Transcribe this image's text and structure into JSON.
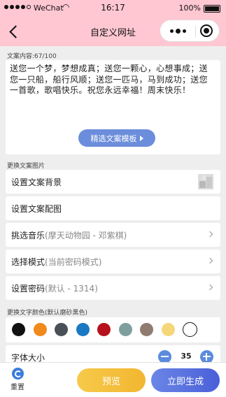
{
  "status_bar": {
    "carrier": "WeChat",
    "time": "16:17",
    "battery": "100%",
    "battery_level": 1.0,
    "signal_bars_filled": 4
  },
  "nav": {
    "title": "自定义网址"
  },
  "text_section": {
    "label": "文案内容:67/100",
    "content": "送您一个梦，梦想成真；送您一颗心，心想事成；送您一只船，船行风顺；送您一匹马，马到成功；送您一首歌，歌唱快乐。祝您永远幸福！周末快乐！",
    "pick_template_button": "精选文案模板"
  },
  "image_section": {
    "label": "更换文案图片",
    "rows": [
      {
        "label": "设置文案背景",
        "sub": ""
      },
      {
        "label": "设置文案配图",
        "sub": ""
      },
      {
        "label": "挑选音乐",
        "sub": "(摩天动物园 - 邓紫棋)"
      },
      {
        "label": "选择模式",
        "sub": "(当前密码模式)"
      },
      {
        "label": "设置密码",
        "sub": "(默认 - 1314)"
      }
    ]
  },
  "color_section": {
    "label": "更换文字颜色(默认磨砂黑色)",
    "colors": [
      "#111111",
      "#f08a1c",
      "#4a5058",
      "#1a79c2",
      "#b5101c",
      "#7f9e9e",
      "#8f7b70",
      "#f5d77a",
      "#ffffff"
    ],
    "selected_index": 8
  },
  "font_section": {
    "label": "字体大小",
    "value": "35"
  },
  "bottom": {
    "reset": "重置",
    "preview": "预览",
    "generate": "立即生成"
  }
}
